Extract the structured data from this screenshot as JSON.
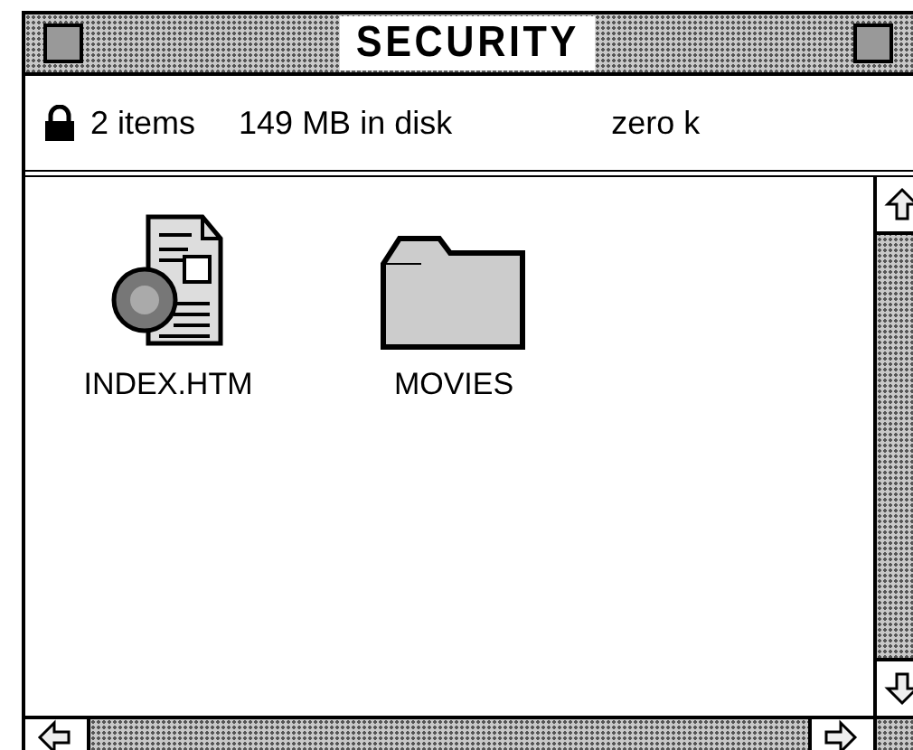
{
  "window": {
    "title": "SECURITY"
  },
  "info_bar": {
    "locked": true,
    "items": "2 items",
    "disk": "149 MB in disk",
    "available": "zero k"
  },
  "items": [
    {
      "name": "INDEX.HTM",
      "kind": "document",
      "selected": false
    },
    {
      "name": "MOVIES",
      "kind": "folder",
      "selected": false
    }
  ]
}
